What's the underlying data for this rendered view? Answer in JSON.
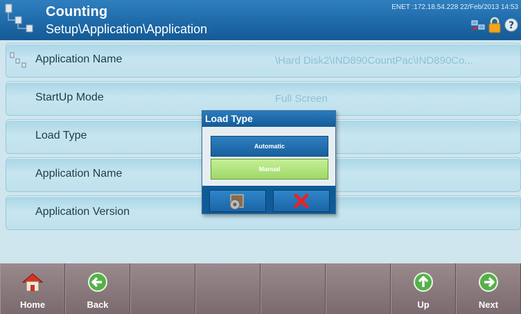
{
  "header": {
    "title": "Counting",
    "path": "Setup\\Application\\Application",
    "status": "ENET :172.18.54.228  22/Feb/2013 14:53"
  },
  "rows": [
    {
      "label": "Application Name",
      "value": "\\Hard Disk2\\IND890CountPac\\IND890Co..."
    },
    {
      "label": "StartUp Mode",
      "value": "Full Screen"
    },
    {
      "label": "Load Type",
      "value": ""
    },
    {
      "label": "Application Name",
      "value": ""
    },
    {
      "label": "Application Version",
      "value": ""
    }
  ],
  "dialog": {
    "title": "Load Type",
    "options": [
      {
        "label": "Automatic",
        "selected": false
      },
      {
        "label": "Manual",
        "selected": true
      }
    ]
  },
  "softkeys": [
    {
      "label": "Home",
      "icon": "home-icon"
    },
    {
      "label": "Back",
      "icon": "arrow-left-icon"
    },
    {
      "label": "",
      "icon": ""
    },
    {
      "label": "",
      "icon": ""
    },
    {
      "label": "",
      "icon": ""
    },
    {
      "label": "",
      "icon": ""
    },
    {
      "label": "Up",
      "icon": "arrow-up-icon"
    },
    {
      "label": "Next",
      "icon": "arrow-right-icon"
    }
  ],
  "colors": {
    "header": "#1f6aa9",
    "row": "#bfe1ed",
    "manual": "#a8df74",
    "automatic": "#1f6aa9",
    "softkey": "#7f6f72"
  }
}
